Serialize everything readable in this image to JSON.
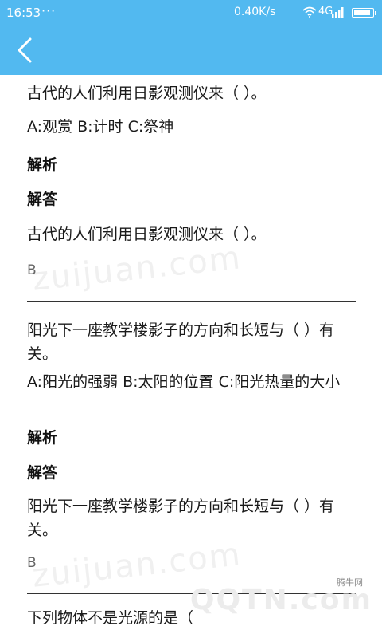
{
  "status": {
    "time": "16:53",
    "dots": "···",
    "speed": "0.40K/s",
    "network": "4G"
  },
  "content": {
    "items": [
      {
        "question": "古代的人们利用日影观测仪来（    ）。",
        "options": "A:观赏 B:计时 C:祭神",
        "analysis_label": "解析",
        "answer_label": "解答",
        "answer_question": "古代的人们利用日影观测仪来（    ）。",
        "answer": "B"
      },
      {
        "question": "阳光下一座教学楼影子的方向和长短与（    ）有关。",
        "options": "A:阳光的强弱 B:太阳的位置 C:阳光热量的大小",
        "analysis_label": "解析",
        "answer_label": "解答",
        "answer_question": "阳光下一座教学楼影子的方向和长短与（    ）有关。",
        "answer": "B"
      },
      {
        "question": "下列物体不是光源的是（"
      }
    ],
    "watermark_text": "zuijuan.com"
  },
  "brand_watermark": {
    "cn": "腾牛网",
    "logo": "QQTN.com"
  }
}
